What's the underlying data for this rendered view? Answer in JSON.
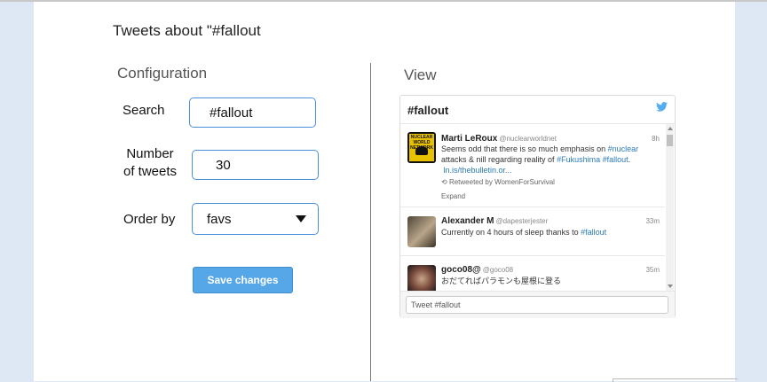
{
  "page": {
    "title": "Tweets about \"#fallout"
  },
  "config": {
    "heading": "Configuration",
    "search_label": "Search",
    "search_value": "#fallout",
    "number_label_line1": "Number",
    "number_label_line2": "of tweets",
    "number_value": "30",
    "order_label": "Order by",
    "order_value": "favs",
    "save_label": "Save changes"
  },
  "view": {
    "heading": "View",
    "widget_title": "#fallout",
    "tweet_input_placeholder": "Tweet #fallout",
    "tweets": [
      {
        "name": "Marti LeRoux",
        "handle": "@nuclearworldnet",
        "time": "8h",
        "text_a": "Seems odd that there is so much emphasis on ",
        "link_a": "#nuclear",
        "text_b": "attacks & nill regarding reality of ",
        "link_b": "#Fukushima",
        "link_c": "#fallout",
        "text_c": ".",
        "link_d": "ln.is/thebulletin.or...",
        "retweet": "Retweeted by WomenForSurvival",
        "expand": "Expand",
        "avatar_text": "NUCLEAR WORLD NETWORK"
      },
      {
        "name": "Alexander M",
        "handle": "@dapesterjester",
        "time": "33m",
        "text_a": "Currently on 4 hours of sleep thanks to ",
        "link_a": "#fallout"
      },
      {
        "name": "goco08@",
        "handle": "@goco08",
        "time": "35m",
        "text_a": "おだてればパラモンも屋根に登る"
      }
    ]
  },
  "colors": {
    "accent": "#55a7e8",
    "link": "#2b7bb9",
    "field_border": "#4a90d9",
    "background": "#dde8f4"
  },
  "icons": {
    "twitter": "twitter-bird-icon",
    "dropdown": "chevron-down-icon",
    "retweet": "retweet-icon"
  }
}
